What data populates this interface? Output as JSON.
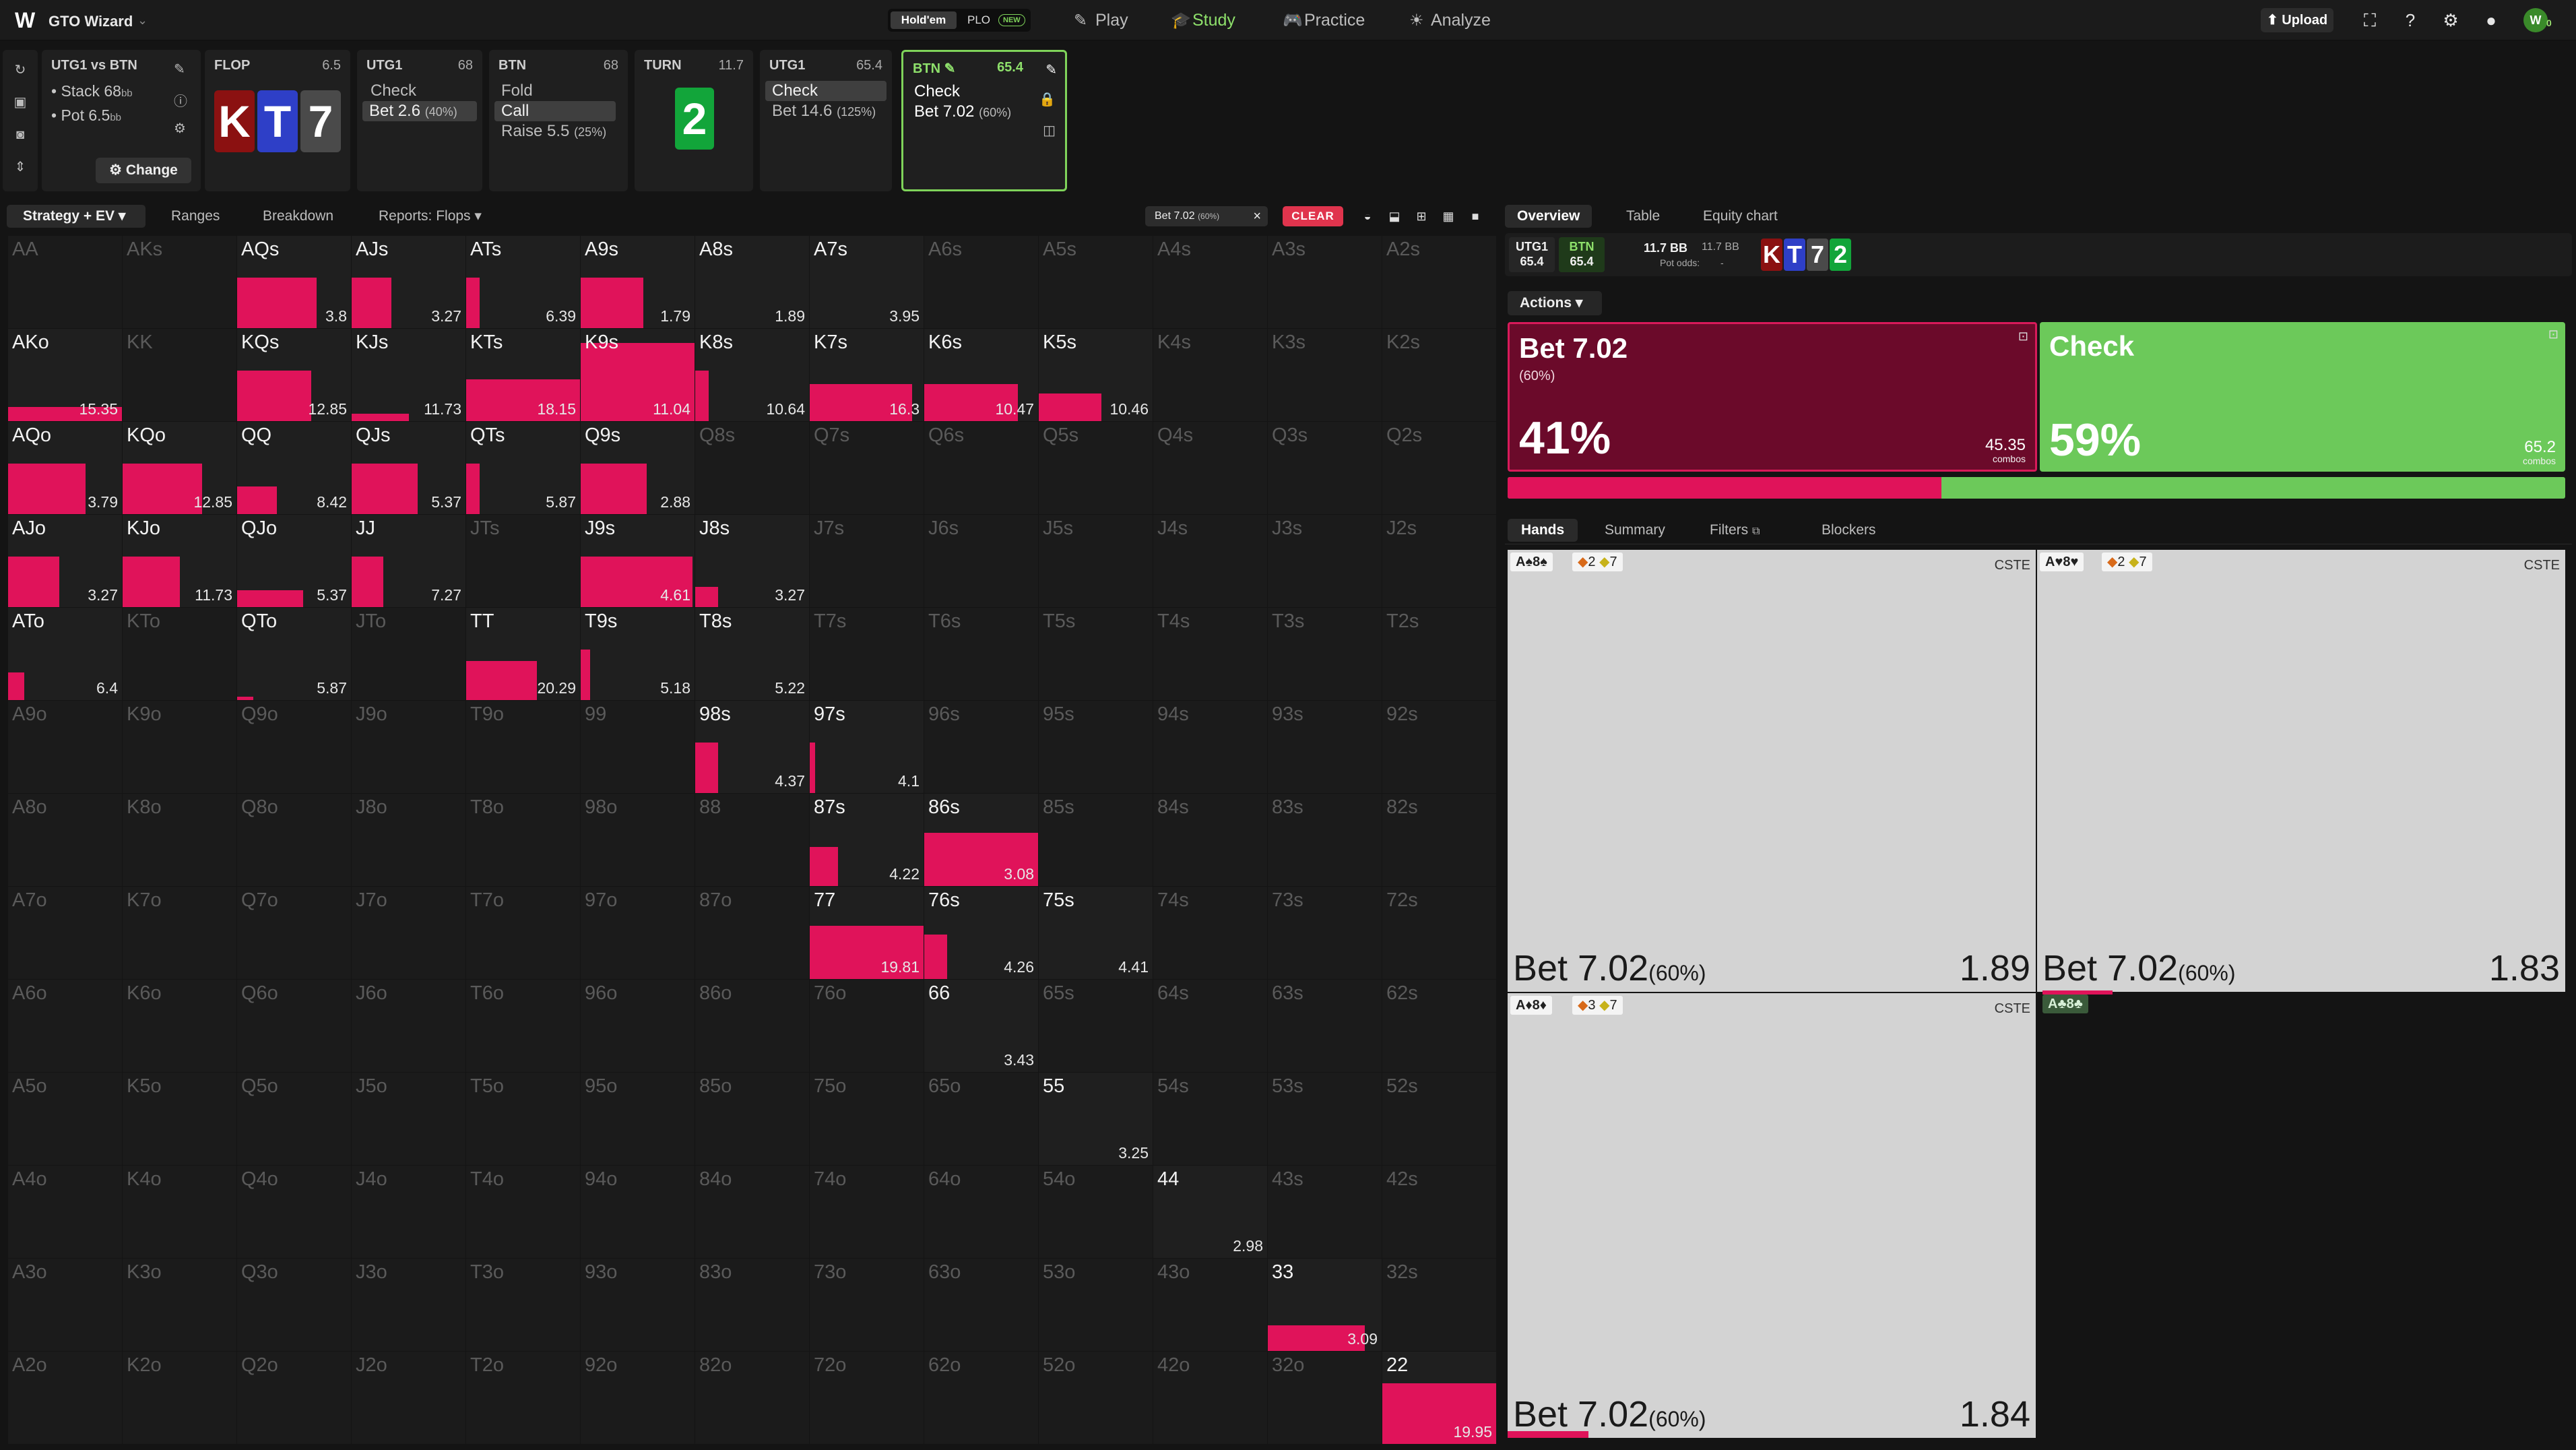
{
  "app": {
    "brand": "GTO Wizard"
  },
  "game_toggle": {
    "holdem": "Hold'em",
    "plo": "PLO",
    "new_badge": "NEW"
  },
  "nav": {
    "play": "Play",
    "study": "Study",
    "practice": "Practice",
    "analyze": "Analyze"
  },
  "topbar": {
    "upload": "Upload"
  },
  "spot": {
    "matchup": "UTG1 vs BTN",
    "stack_label": "• Stack 68",
    "pot_label": "• Pot 6.5",
    "bb": "bb",
    "change_label": "Change"
  },
  "history": {
    "flop": {
      "title": "FLOP",
      "value": "6.5",
      "cards": [
        "K",
        "T",
        "7"
      ]
    },
    "utg1_a": {
      "title": "UTG1",
      "value": "68",
      "options": [
        {
          "label": "Check",
          "pct": ""
        },
        {
          "label": "Bet 2.6",
          "pct": "(40%)"
        }
      ]
    },
    "btn": {
      "title": "BTN",
      "value": "68",
      "options": [
        {
          "label": "Fold",
          "pct": ""
        },
        {
          "label": "Call",
          "pct": ""
        },
        {
          "label": "Raise 5.5",
          "pct": "(25%)"
        }
      ]
    },
    "turn": {
      "title": "TURN",
      "value": "11.7",
      "card": "2"
    },
    "utg1_b": {
      "title": "UTG1",
      "value": "65.4",
      "options": [
        {
          "label": "Check",
          "pct": ""
        },
        {
          "label": "Bet 14.6",
          "pct": "(125%)"
        }
      ]
    },
    "btn_active": {
      "title": "BTN",
      "value": "65.4",
      "options": [
        {
          "label": "Check",
          "pct": ""
        },
        {
          "label": "Bet 7.02",
          "pct": "(60%)"
        }
      ]
    }
  },
  "toolbar": {
    "strategy": "Strategy + EV",
    "ranges": "Ranges",
    "breakdown": "Breakdown",
    "reports": "Reports: Flops",
    "filter_chip": "Bet 7.02",
    "filter_chip_pct": "(60%)",
    "clear": "CLEAR"
  },
  "grid": [
    [
      {
        "l": "AA",
        "d": true
      },
      {
        "l": "AKs",
        "d": true
      },
      {
        "l": "AQs",
        "f": 0.7,
        "ev": "3.8"
      },
      {
        "l": "AJs",
        "f": 0.35,
        "ev": "3.27"
      },
      {
        "l": "ATs",
        "f": 0.12,
        "ev": "6.39"
      },
      {
        "l": "A9s",
        "f": 0.55,
        "ev": "1.79"
      },
      {
        "l": "A8s",
        "f": 0,
        "ev": "1.89"
      },
      {
        "l": "A7s",
        "f": 0,
        "ev": "3.95"
      },
      {
        "l": "A6s",
        "d": true
      },
      {
        "l": "A5s",
        "d": true
      },
      {
        "l": "A4s",
        "d": true
      },
      {
        "l": "A3s",
        "d": true
      },
      {
        "l": "A2s",
        "d": true
      }
    ],
    [
      {
        "l": "AKo",
        "f": 1,
        "h": 0.15,
        "ev": "15.35"
      },
      {
        "l": "KK",
        "d": true
      },
      {
        "l": "KQs",
        "f": 0.65,
        "ev": "12.85"
      },
      {
        "l": "KJs",
        "f": 0.5,
        "h": 0.08,
        "ev": "11.73"
      },
      {
        "l": "KTs",
        "f": 1,
        "h": 0.45,
        "ev": "18.15"
      },
      {
        "l": "K9s",
        "f": 1,
        "h": 0.85,
        "ev": "11.04"
      },
      {
        "l": "K8s",
        "f": 0.12,
        "ev": "10.64"
      },
      {
        "l": "K7s",
        "f": 0.9,
        "h": 0.4,
        "ev": "16.3"
      },
      {
        "l": "K6s",
        "f": 0.82,
        "h": 0.4,
        "ev": "10.47"
      },
      {
        "l": "K5s",
        "f": 0.55,
        "h": 0.3,
        "ev": "10.46"
      },
      {
        "l": "K4s",
        "d": true
      },
      {
        "l": "K3s",
        "d": true
      },
      {
        "l": "K2s",
        "d": true
      }
    ],
    [
      {
        "l": "AQo",
        "f": 0.68,
        "ev": "3.79"
      },
      {
        "l": "KQo",
        "f": 0.7,
        "ev": "12.85"
      },
      {
        "l": "QQ",
        "f": 0.35,
        "h": 0.3,
        "ev": "8.42"
      },
      {
        "l": "QJs",
        "f": 0.58,
        "ev": "5.37"
      },
      {
        "l": "QTs",
        "f": 0.12,
        "ev": "5.87"
      },
      {
        "l": "Q9s",
        "f": 0.58,
        "ev": "2.88"
      },
      {
        "l": "Q8s",
        "d": true
      },
      {
        "l": "Q7s",
        "d": true
      },
      {
        "l": "Q6s",
        "d": true
      },
      {
        "l": "Q5s",
        "d": true
      },
      {
        "l": "Q4s",
        "d": true
      },
      {
        "l": "Q3s",
        "d": true
      },
      {
        "l": "Q2s",
        "d": true
      }
    ],
    [
      {
        "l": "AJo",
        "f": 0.45,
        "ev": "3.27"
      },
      {
        "l": "KJo",
        "f": 0.5,
        "ev": "11.73"
      },
      {
        "l": "QJo",
        "f": 0.58,
        "h": 0.18,
        "ev": "5.37"
      },
      {
        "l": "JJ",
        "f": 0.28,
        "ev": "7.27"
      },
      {
        "l": "JTs",
        "d": true
      },
      {
        "l": "J9s",
        "f": 0.98,
        "ev": "4.61"
      },
      {
        "l": "J8s",
        "f": 0.2,
        "h": 0.22,
        "ev": "3.27"
      },
      {
        "l": "J7s",
        "d": true
      },
      {
        "l": "J6s",
        "d": true
      },
      {
        "l": "J5s",
        "d": true
      },
      {
        "l": "J4s",
        "d": true
      },
      {
        "l": "J3s",
        "d": true
      },
      {
        "l": "J2s",
        "d": true
      }
    ],
    [
      {
        "l": "ATo",
        "f": 0.14,
        "h": 0.3,
        "ev": "6.4"
      },
      {
        "l": "KTo",
        "d": true
      },
      {
        "l": "QTo",
        "f": 0.14,
        "h": 0.04,
        "ev": "5.87"
      },
      {
        "l": "JTo",
        "d": true
      },
      {
        "l": "TT",
        "f": 0.62,
        "h": 0.42,
        "ev": "20.29"
      },
      {
        "l": "T9s",
        "f": 0.08,
        "ev": "5.18"
      },
      {
        "l": "T8s",
        "f": 0,
        "ev": "5.22"
      },
      {
        "l": "T7s",
        "d": true
      },
      {
        "l": "T6s",
        "d": true
      },
      {
        "l": "T5s",
        "d": true
      },
      {
        "l": "T4s",
        "d": true
      },
      {
        "l": "T3s",
        "d": true
      },
      {
        "l": "T2s",
        "d": true
      }
    ],
    [
      {
        "l": "A9o",
        "d": true
      },
      {
        "l": "K9o",
        "d": true
      },
      {
        "l": "Q9o",
        "d": true
      },
      {
        "l": "J9o",
        "d": true
      },
      {
        "l": "T9o",
        "d": true
      },
      {
        "l": "99",
        "d": true
      },
      {
        "l": "98s",
        "f": 0.2,
        "ev": "4.37"
      },
      {
        "l": "97s",
        "f": 0.05,
        "ev": "4.1"
      },
      {
        "l": "96s",
        "d": true
      },
      {
        "l": "95s",
        "d": true
      },
      {
        "l": "94s",
        "d": true
      },
      {
        "l": "93s",
        "d": true
      },
      {
        "l": "92s",
        "d": true
      }
    ],
    [
      {
        "l": "A8o",
        "d": true
      },
      {
        "l": "K8o",
        "d": true
      },
      {
        "l": "Q8o",
        "d": true
      },
      {
        "l": "J8o",
        "d": true
      },
      {
        "l": "T8o",
        "d": true
      },
      {
        "l": "98o",
        "d": true
      },
      {
        "l": "88",
        "d": true
      },
      {
        "l": "87s",
        "f": 0.25,
        "h": 0.42,
        "ev": "4.22"
      },
      {
        "l": "86s",
        "f": 1,
        "h": 0.58,
        "ev": "3.08"
      },
      {
        "l": "85s",
        "d": true
      },
      {
        "l": "84s",
        "d": true
      },
      {
        "l": "83s",
        "d": true
      },
      {
        "l": "82s",
        "d": true
      }
    ],
    [
      {
        "l": "A7o",
        "d": true
      },
      {
        "l": "K7o",
        "d": true
      },
      {
        "l": "Q7o",
        "d": true
      },
      {
        "l": "J7o",
        "d": true
      },
      {
        "l": "T7o",
        "d": true
      },
      {
        "l": "97o",
        "d": true
      },
      {
        "l": "87o",
        "d": true
      },
      {
        "l": "77",
        "f": 1,
        "h": 0.58,
        "ev": "19.81"
      },
      {
        "l": "76s",
        "f": 0.2,
        "h": 0.48,
        "ev": "4.26"
      },
      {
        "l": "75s",
        "f": 0,
        "ev": "4.41"
      },
      {
        "l": "74s",
        "d": true
      },
      {
        "l": "73s",
        "d": true
      },
      {
        "l": "72s",
        "d": true
      }
    ],
    [
      {
        "l": "A6o",
        "d": true
      },
      {
        "l": "K6o",
        "d": true
      },
      {
        "l": "Q6o",
        "d": true
      },
      {
        "l": "J6o",
        "d": true
      },
      {
        "l": "T6o",
        "d": true
      },
      {
        "l": "96o",
        "d": true
      },
      {
        "l": "86o",
        "d": true
      },
      {
        "l": "76o",
        "d": true
      },
      {
        "l": "66",
        "f": 0,
        "ev": "3.43"
      },
      {
        "l": "65s",
        "d": true
      },
      {
        "l": "64s",
        "d": true
      },
      {
        "l": "63s",
        "d": true
      },
      {
        "l": "62s",
        "d": true
      }
    ],
    [
      {
        "l": "A5o",
        "d": true
      },
      {
        "l": "K5o",
        "d": true
      },
      {
        "l": "Q5o",
        "d": true
      },
      {
        "l": "J5o",
        "d": true
      },
      {
        "l": "T5o",
        "d": true
      },
      {
        "l": "95o",
        "d": true
      },
      {
        "l": "85o",
        "d": true
      },
      {
        "l": "75o",
        "d": true
      },
      {
        "l": "65o",
        "d": true
      },
      {
        "l": "55",
        "f": 0,
        "ev": "3.25"
      },
      {
        "l": "54s",
        "d": true
      },
      {
        "l": "53s",
        "d": true
      },
      {
        "l": "52s",
        "d": true
      }
    ],
    [
      {
        "l": "A4o",
        "d": true
      },
      {
        "l": "K4o",
        "d": true
      },
      {
        "l": "Q4o",
        "d": true
      },
      {
        "l": "J4o",
        "d": true
      },
      {
        "l": "T4o",
        "d": true
      },
      {
        "l": "94o",
        "d": true
      },
      {
        "l": "84o",
        "d": true
      },
      {
        "l": "74o",
        "d": true
      },
      {
        "l": "64o",
        "d": true
      },
      {
        "l": "54o",
        "d": true
      },
      {
        "l": "44",
        "f": 0,
        "ev": "2.98"
      },
      {
        "l": "43s",
        "d": true
      },
      {
        "l": "42s",
        "d": true
      }
    ],
    [
      {
        "l": "A3o",
        "d": true
      },
      {
        "l": "K3o",
        "d": true
      },
      {
        "l": "Q3o",
        "d": true
      },
      {
        "l": "J3o",
        "d": true
      },
      {
        "l": "T3o",
        "d": true
      },
      {
        "l": "93o",
        "d": true
      },
      {
        "l": "83o",
        "d": true
      },
      {
        "l": "73o",
        "d": true
      },
      {
        "l": "63o",
        "d": true
      },
      {
        "l": "53o",
        "d": true
      },
      {
        "l": "43o",
        "d": true
      },
      {
        "l": "33",
        "f": 0.85,
        "h": 0.28,
        "ev": "3.09"
      },
      {
        "l": "32s",
        "d": true
      }
    ],
    [
      {
        "l": "A2o",
        "d": true
      },
      {
        "l": "K2o",
        "d": true
      },
      {
        "l": "Q2o",
        "d": true
      },
      {
        "l": "J2o",
        "d": true
      },
      {
        "l": "T2o",
        "d": true
      },
      {
        "l": "92o",
        "d": true
      },
      {
        "l": "82o",
        "d": true
      },
      {
        "l": "72o",
        "d": true
      },
      {
        "l": "62o",
        "d": true
      },
      {
        "l": "52o",
        "d": true
      },
      {
        "l": "42o",
        "d": true
      },
      {
        "l": "32o",
        "d": true
      },
      {
        "l": "22",
        "f": 1,
        "h": 0.66,
        "ev": "19.95"
      }
    ]
  ],
  "right_tabs": {
    "overview": "Overview",
    "table": "Table",
    "equity": "Equity chart"
  },
  "summary": {
    "utg1_label": "UTG1",
    "utg1_value": "65.4",
    "btn_label": "BTN",
    "btn_value": "65.4",
    "pot_bb": "11.7 BB",
    "pot_bb2": "11.7 BB",
    "pot_odds": "Pot odds:",
    "pot_odds_value": "-",
    "board": [
      "K",
      "T",
      "7",
      "2"
    ]
  },
  "actions": {
    "dropdown": "Actions",
    "bet": {
      "name": "Bet 7.02",
      "sub": "(60%)",
      "pct": "41%",
      "combos": "45.35",
      "combos_label": "combos",
      "frequency": 0.41
    },
    "check": {
      "name": "Check",
      "pct": "59%",
      "combos": "65.2",
      "combos_label": "combos"
    }
  },
  "hands_tabs": {
    "hands": "Hands",
    "summary": "Summary",
    "filters": "Filters",
    "blockers": "Blockers"
  },
  "hand_panels": [
    {
      "hand": "A♠8♠",
      "b1": "2",
      "b2": "7",
      "cste": "CSTE",
      "action": "Bet 7.02",
      "pct": "(60%)",
      "ev": "1.89"
    },
    {
      "hand": "A♥8♥",
      "b1": "2",
      "b2": "7",
      "cste": "CSTE",
      "action": "Bet 7.02",
      "pct": "(60%)",
      "ev": "1.83"
    },
    {
      "hand": "A♦8♦",
      "b1": "3",
      "b2": "7",
      "cste": "CSTE",
      "action": "Bet 7.02",
      "pct": "(60%)",
      "ev": "1.84"
    }
  ],
  "small_hand": "A♣8♣"
}
